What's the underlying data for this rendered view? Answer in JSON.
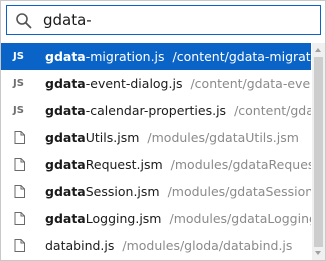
{
  "search": {
    "value": "gdata-"
  },
  "results": [
    {
      "type": "js",
      "badge": "JS",
      "match": "gdata",
      "rest": "-migration.js",
      "path": "/content/gdata-migratio...",
      "selected": true
    },
    {
      "type": "js",
      "badge": "JS",
      "match": "gdata",
      "rest": "-event-dialog.js",
      "path": "/content/gdata-event...",
      "selected": false
    },
    {
      "type": "js",
      "badge": "JS",
      "match": "gdata",
      "rest": "-calendar-properties.js",
      "path": "/content/gdata...",
      "selected": false
    },
    {
      "type": "file",
      "badge": "",
      "match": "gdata",
      "rest": "Utils.jsm",
      "path": "/modules/gdataUtils.jsm",
      "selected": false
    },
    {
      "type": "file",
      "badge": "",
      "match": "gdata",
      "rest": "Request.jsm",
      "path": "/modules/gdataRequest.j...",
      "selected": false
    },
    {
      "type": "file",
      "badge": "",
      "match": "gdata",
      "rest": "Session.jsm",
      "path": "/modules/gdataSession.jsm",
      "selected": false
    },
    {
      "type": "file",
      "badge": "",
      "match": "gdata",
      "rest": "Logging.jsm",
      "path": "/modules/gdataLogging.j...",
      "selected": false
    },
    {
      "type": "file",
      "badge": "",
      "match": "",
      "rest": "databind.js",
      "path": "/modules/gloda/databind.js",
      "selected": false
    }
  ],
  "colors": {
    "accent": "#0a64c8",
    "path_text": "#8a8a8a",
    "badge_text": "#6e6e6e"
  },
  "icons": {
    "search": "search-icon",
    "file": "file-icon"
  }
}
